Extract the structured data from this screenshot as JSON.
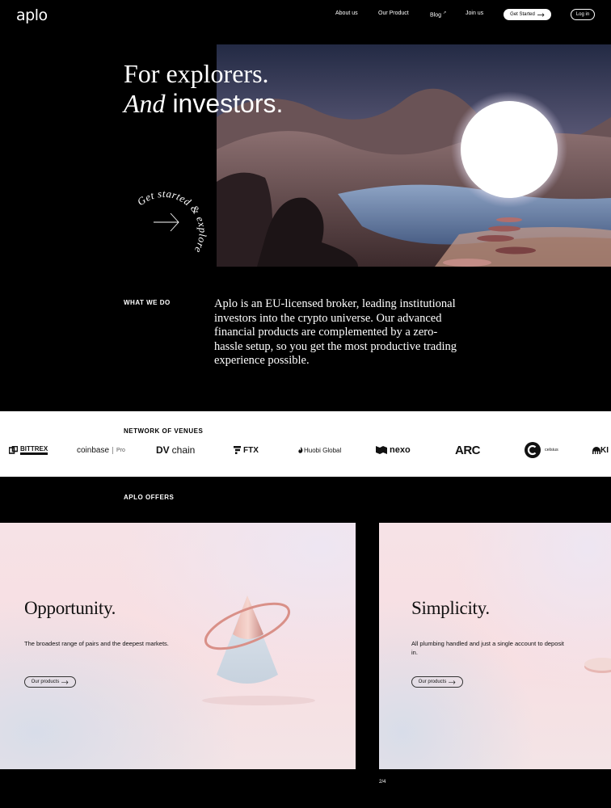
{
  "header": {
    "logo": "aplo",
    "nav": [
      {
        "label": "About us",
        "name": "nav-about-us"
      },
      {
        "label": "Our Product",
        "name": "nav-our-product"
      },
      {
        "label": "Blog",
        "name": "nav-blog"
      },
      {
        "label": "Join us",
        "name": "nav-join-us"
      }
    ],
    "blog_external_mark": "↗",
    "get_started": "Get Started",
    "login": "Log in"
  },
  "hero": {
    "line1": "For explorers.",
    "line2_italic": "And",
    "line2_rest": " investors.",
    "explore_cta": "Get started & explore"
  },
  "what_we_do": {
    "label": "WHAT WE DO",
    "text": "Aplo is an EU-licensed broker, leading institutional investors into the crypto universe. Our advanced financial products are complemented by a zero-hassle setup, so you get the most productive trading experience possible."
  },
  "network": {
    "label": "NETWORK OF VENUES",
    "venues": {
      "bittrex": "BITTREX",
      "coinbase": "coinbase",
      "coinbase_pro": "Pro",
      "dvchain_a": "DV",
      "dvchain_b": "chain",
      "ftx": "FTX",
      "huobi": "Huobi Global",
      "nexo": "nexo",
      "arc": "ARC",
      "celsius": "celsius",
      "partial": "KI"
    }
  },
  "offers": {
    "label": "APLO OFFERS",
    "cards": [
      {
        "title": "Opportunity.",
        "text": "The broadest range of pairs and the deepest markets.",
        "cta": "Our products"
      },
      {
        "title": "Simplicity.",
        "text": "All plumbing handled and just a single account to deposit in.",
        "cta": "Our products"
      }
    ],
    "pager": "2/4"
  },
  "colors": {
    "background": "#000000",
    "band": "#ffffff",
    "card_pink": "#f8dfe2",
    "cone_ring": "#d99088"
  }
}
